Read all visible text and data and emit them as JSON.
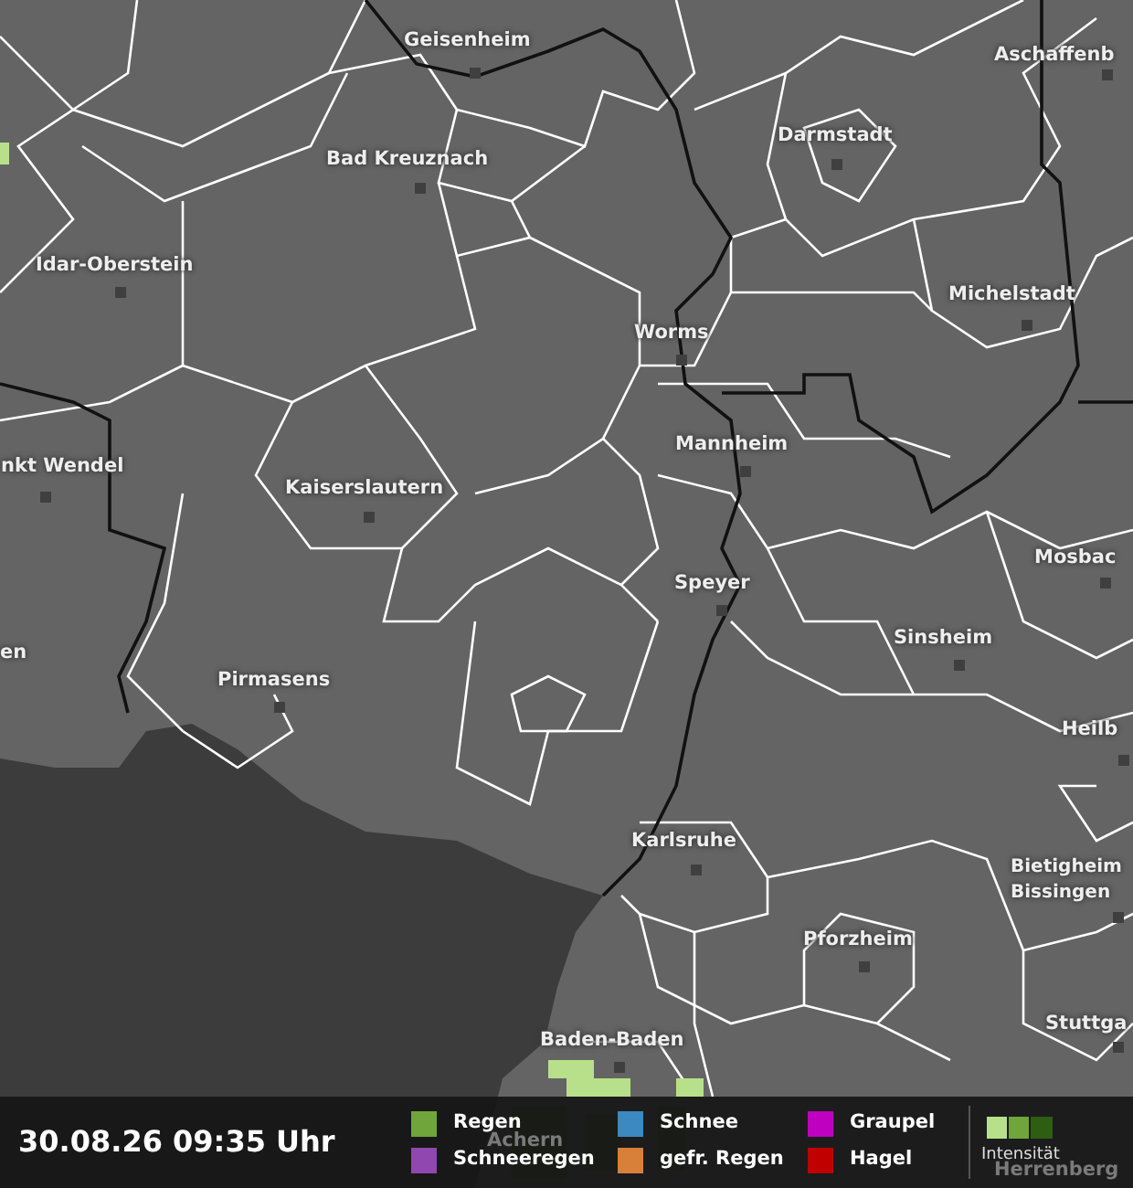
{
  "map": {
    "cities": [
      {
        "label": "Geisenheim"
      },
      {
        "label": "Bad Kreuznach"
      },
      {
        "label": "Idar-Oberstein"
      },
      {
        "label": "Darmstadt"
      },
      {
        "label": "Aschaffenb"
      },
      {
        "label": "Michelstadt"
      },
      {
        "label": "Worms"
      },
      {
        "label": "Mannheim"
      },
      {
        "label": "nkt Wendel"
      },
      {
        "label": "Kaiserslautern"
      },
      {
        "label": "Speyer"
      },
      {
        "label": "Mosbac"
      },
      {
        "label": "en"
      },
      {
        "label": "Sinsheim"
      },
      {
        "label": "Pirmasens"
      },
      {
        "label": "Heilb"
      },
      {
        "label": "Karlsruhe"
      },
      {
        "label": "Bietigheim Bissingen"
      },
      {
        "label": "Pforzheim"
      },
      {
        "label": "Stuttga"
      },
      {
        "label": "Baden-Baden"
      },
      {
        "label": "Achern"
      },
      {
        "label": "Herrenberg"
      }
    ]
  },
  "status_bar": {
    "timestamp": "30.08.26 09:35 Uhr",
    "legend": [
      {
        "label": "Regen",
        "color": "#6fa53a"
      },
      {
        "label": "Schnee",
        "color": "#3c88c0"
      },
      {
        "label": "Graupel",
        "color": "#c000c0"
      },
      {
        "label": "Schneeregen",
        "color": "#9048b0"
      },
      {
        "label": "gefr. Regen",
        "color": "#d8803a"
      },
      {
        "label": "Hagel",
        "color": "#c00000"
      }
    ],
    "intensity_label": "Intensität"
  }
}
